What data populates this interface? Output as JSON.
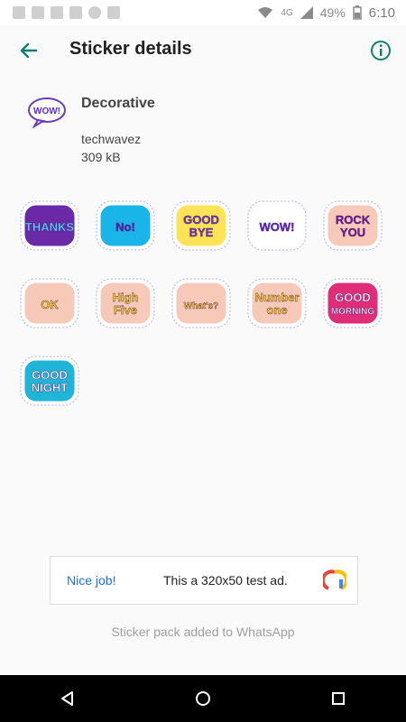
{
  "statusbar": {
    "battery_percent": "49%",
    "time": "6:10",
    "network": "4G"
  },
  "appbar": {
    "title": "Sticker details",
    "back_icon": "arrow-back-icon",
    "info_icon": "info-icon",
    "accent_color": "#0f7f6d"
  },
  "pack": {
    "name": "Decorative",
    "author": "techwavez",
    "size": "309 kB",
    "tray_text": "WOW!"
  },
  "stickers": [
    {
      "name": "thanks",
      "text": "THANKS",
      "bg": "#6a2aa7",
      "fg": "#4fe1ff"
    },
    {
      "name": "no",
      "text": "No!",
      "bg": "#19b4e8",
      "fg": "#5d1bb5"
    },
    {
      "name": "good-bye",
      "text": "GOOD BYE",
      "bg": "#ffe357",
      "fg": "#6b3bb8"
    },
    {
      "name": "wow",
      "text": "WOW!",
      "bg": "#ffffff",
      "fg": "#5b2ad0"
    },
    {
      "name": "rock-you",
      "text": "ROCK YOU",
      "bg": "#f6c9b8",
      "fg": "#6d1f8a"
    },
    {
      "name": "ok",
      "text": "OK",
      "bg": "#f6c9b8",
      "fg": "#f9d400"
    },
    {
      "name": "high-five",
      "text": "High Five",
      "bg": "#f6c9b8",
      "fg": "#f9d400"
    },
    {
      "name": "whats",
      "text": "What's?",
      "bg": "#f6c9b8",
      "fg": "#ffd400"
    },
    {
      "name": "number-one",
      "text": "Number one",
      "bg": "#f6c9b8",
      "fg": "#ffd400"
    },
    {
      "name": "good-morning",
      "text": "GOOD MORNING",
      "bg": "#e02d77",
      "fg": "#ffffff"
    },
    {
      "name": "good-night",
      "text": "GOOD NIGHT",
      "bg": "#1fb5d6",
      "fg": "#ffffff"
    }
  ],
  "ad": {
    "nice_label": "Nice job!",
    "text": "This a 320x50 test ad."
  },
  "toast": "Sticker pack added to WhatsApp",
  "navbar": {
    "back_icon": "nav-back-icon",
    "home_icon": "nav-home-icon",
    "recents_icon": "nav-recents-icon"
  }
}
